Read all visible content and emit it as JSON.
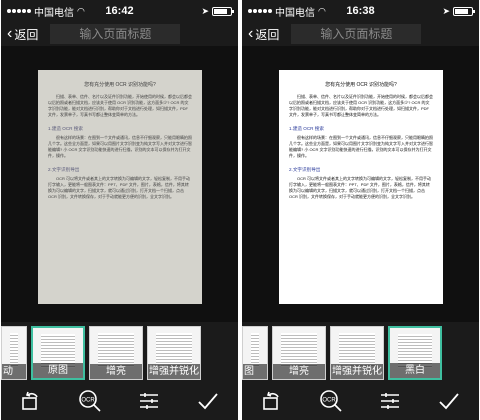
{
  "screens": [
    {
      "status": {
        "carrier": "中国电信",
        "wifi": "wifi-icon",
        "time": "16:42",
        "status_icons": "location-icon"
      },
      "nav": {
        "back_label": "返回",
        "title_placeholder": "输入页面标题"
      },
      "document": {
        "title": "您有充分使用 OCR 识别功能吗?",
        "intro": "扫描、表单、信件、名片以及证件识别功能，开始使用的时候，都会以后都会以后拍照或者扫描文档，应该关于使用 OCR 识别功能，这方面多少? OCR 的文字识别功能，能对文档进行识别，帮助你对于文档进行处理，如扫描文件，PDF 文件，发票单子，写真书写都让整体变简单的方法。",
        "section1_heading": "1.建造 OCR 搜索",
        "section1_text": "很有这样的场景：在图到一个文件或通讯，信息不仔细观察，只能用眼睛拍照几个字。这些全方面是，如果可以用图片文字识别变为纯文字写入并对文字进行智能编辑? 小 OCR 文字识别功能快速的进行扫描，识别的文本可以保存并为打开文件，操作。",
        "section2_heading": "2.文字识别导出",
        "section2_text": "OCR 可以将文件或者其上的文字转换为可编辑的文字，轻松复制，不用手动打字输入，更能将一般图表文件：PPT、PDF 文件，图片，表格，信件，将其转换为可以编辑的文字，扫描文字，就可以通过识别，打开文档一个扫描，点击 OCR 识别，文件转换保存，对于手动就能更方便的识别，全文字识别。"
      },
      "filters": [
        {
          "label": "动",
          "partial": true,
          "selected": false
        },
        {
          "label": "原图",
          "partial": false,
          "selected": true
        },
        {
          "label": "增亮",
          "partial": false,
          "selected": false
        },
        {
          "label": "增强并锐化",
          "partial": false,
          "selected": false
        }
      ],
      "toolbar": [
        "rotate-icon",
        "ocr-icon",
        "adjust-icon",
        "confirm-check-icon"
      ]
    },
    {
      "status": {
        "carrier": "中国电信",
        "wifi": "wifi-icon",
        "time": "16:38",
        "status_icons": "location-icon"
      },
      "nav": {
        "back_label": "返回",
        "title_placeholder": "输入页面标题"
      },
      "document": {
        "title": "您有充分使用 OCR 识别功能吗?",
        "intro": "扫描、表单、信件、名片以及证件识别功能，开始使用的时候，都会以后都会以后拍照或者扫描文档，应该关于使用 OCR 识别功能，这方面多少? OCR 的文字识别功能，能对文档进行识别，帮助你对于文档进行处理，如扫描文件，PDF 文件，发票单子，写真书写都让整体变简单的方法。",
        "section1_heading": "1.建造 OCR 搜索",
        "section1_text": "很有这样的场景：在图到一个文件或通讯，信息不仔细观察，只能用眼睛拍照几个字。这些全方面是，如果可以用图片文字识别变为纯文字写入并对文字进行智能编辑? 小 OCR 文字识别功能快速的进行扫描，识别的文本可以保存并为打开文件，操作。",
        "section2_heading": "2.文字识别导出",
        "section2_text": "OCR 可以将文件或者其上的文字转换为可编辑的文字，轻松复制，不用手动打字输入，更能将一般图表文件：PPT、PDF 文件，图片，表格，信件，将其转换为可以编辑的文字，扫描文字，就可以通过识别，打开文档一个扫描，点击 OCR 识别，文件转换保存，对于手动就能更方便的识别，全文字识别。"
      },
      "filters": [
        {
          "label": "图",
          "partial": true,
          "selected": false
        },
        {
          "label": "增亮",
          "partial": false,
          "selected": false
        },
        {
          "label": "增强并锐化",
          "partial": false,
          "selected": false
        },
        {
          "label": "黑白",
          "partial": false,
          "selected": true
        }
      ],
      "toolbar": [
        "rotate-icon",
        "ocr-icon",
        "adjust-icon",
        "confirm-check-icon"
      ]
    }
  ]
}
